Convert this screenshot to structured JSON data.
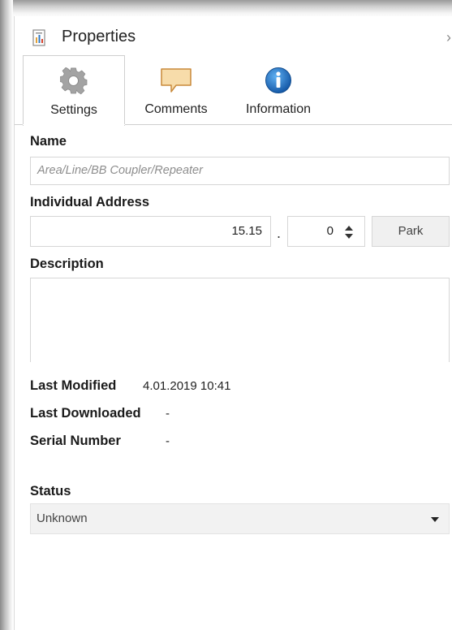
{
  "panel": {
    "title": "Properties",
    "collapse_glyph": "›"
  },
  "tabs": [
    {
      "label": "Settings",
      "icon": "gear-icon",
      "active": true
    },
    {
      "label": "Comments",
      "icon": "comment-icon",
      "active": false
    },
    {
      "label": "Information",
      "icon": "info-icon",
      "active": false
    }
  ],
  "settings": {
    "name_label": "Name",
    "name_placeholder": "Area/Line/BB Coupler/Repeater",
    "address_label": "Individual Address",
    "address_main": "15.15",
    "address_separator": ".",
    "address_sub": "0",
    "park_label": "Park",
    "description_label": "Description",
    "description_value": "",
    "last_modified_label": "Last Modified",
    "last_modified_value": "4.01.2019 10:41",
    "last_downloaded_label": "Last Downloaded",
    "last_downloaded_value": "-",
    "serial_number_label": "Serial Number",
    "serial_number_value": "-",
    "status_label": "Status",
    "status_value": "Unknown"
  },
  "colors": {
    "comment_icon": "#f6d9a2",
    "info_icon": "#1f6fbf",
    "gear_icon": "#9a9a9a"
  }
}
